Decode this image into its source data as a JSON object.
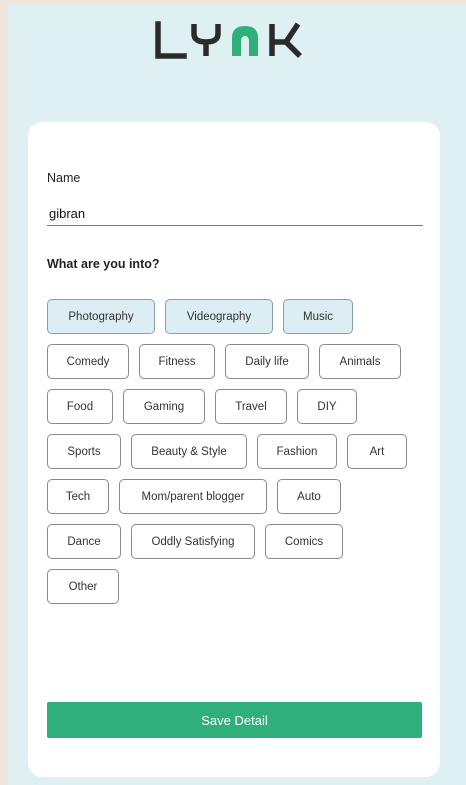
{
  "app": {
    "logo_text": "LYNK"
  },
  "form": {
    "name_label": "Name",
    "name_value": "gibran",
    "interests_label": "What are you into?",
    "save_label": "Save Detail"
  },
  "tag_rows": [
    [
      {
        "label": "Photography",
        "selected": true
      },
      {
        "label": "Videography",
        "selected": true
      },
      {
        "label": "Music",
        "selected": true
      }
    ],
    [
      {
        "label": "Comedy",
        "selected": false
      },
      {
        "label": "Fitness",
        "selected": false
      },
      {
        "label": "Daily life",
        "selected": false
      },
      {
        "label": "Animals",
        "selected": false
      }
    ],
    [
      {
        "label": "Food",
        "selected": false
      },
      {
        "label": "Gaming",
        "selected": false
      },
      {
        "label": "Travel",
        "selected": false
      },
      {
        "label": "DIY",
        "selected": false
      }
    ],
    [
      {
        "label": "Sports",
        "selected": false
      },
      {
        "label": "Beauty & Style",
        "selected": false
      },
      {
        "label": "Fashion",
        "selected": false
      },
      {
        "label": "Art",
        "selected": false
      }
    ],
    [
      {
        "label": "Tech",
        "selected": false
      },
      {
        "label": "Mom/parent blogger",
        "selected": false
      },
      {
        "label": "Auto",
        "selected": false
      }
    ],
    [
      {
        "label": "Dance",
        "selected": false
      },
      {
        "label": "Oddly Satisfying",
        "selected": false
      },
      {
        "label": "Comics",
        "selected": false
      }
    ],
    [
      {
        "label": "Other",
        "selected": false
      }
    ]
  ],
  "colors": {
    "accent": "#2fb07a",
    "selected_tag": "#dcedf4",
    "background": "#dff0f3"
  }
}
